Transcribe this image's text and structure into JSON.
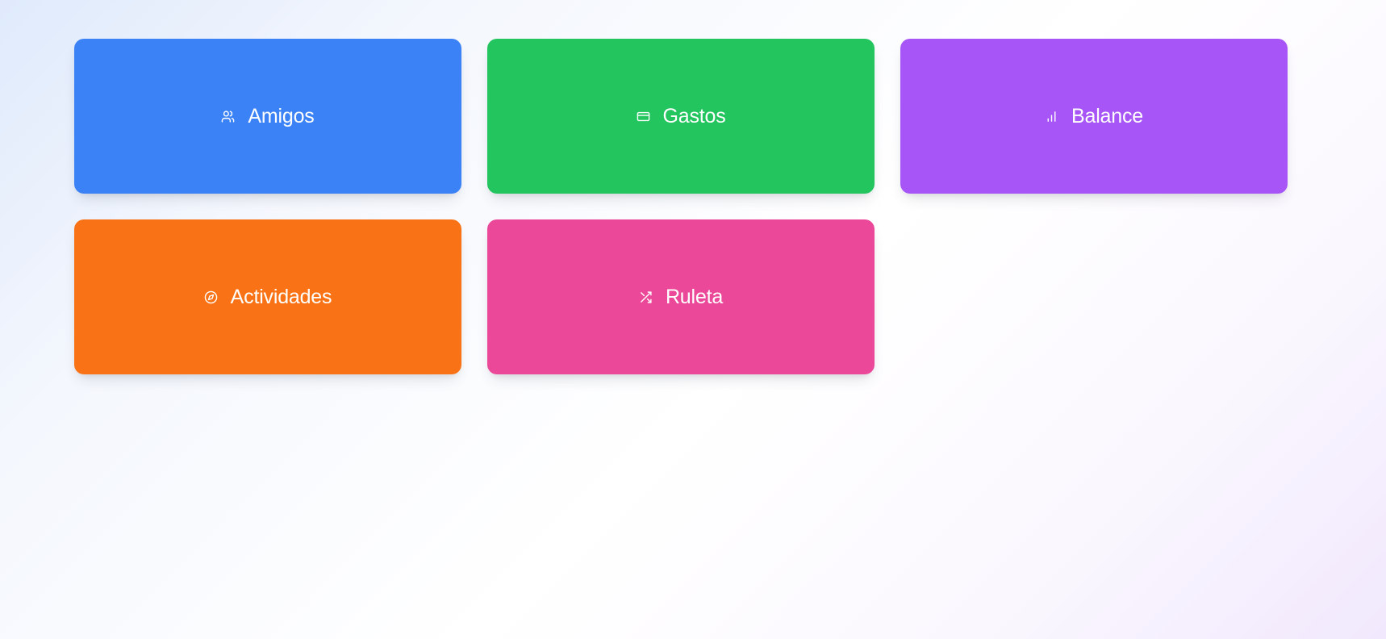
{
  "tiles": [
    {
      "label": "Amigos",
      "icon": "users-icon",
      "color": "#3b82f6"
    },
    {
      "label": "Gastos",
      "icon": "credit-card-icon",
      "color": "#22c55e"
    },
    {
      "label": "Balance",
      "icon": "bar-chart-icon",
      "color": "#a855f7"
    },
    {
      "label": "Actividades",
      "icon": "compass-icon",
      "color": "#f97316"
    },
    {
      "label": "Ruleta",
      "icon": "shuffle-icon",
      "color": "#ec4899"
    }
  ]
}
